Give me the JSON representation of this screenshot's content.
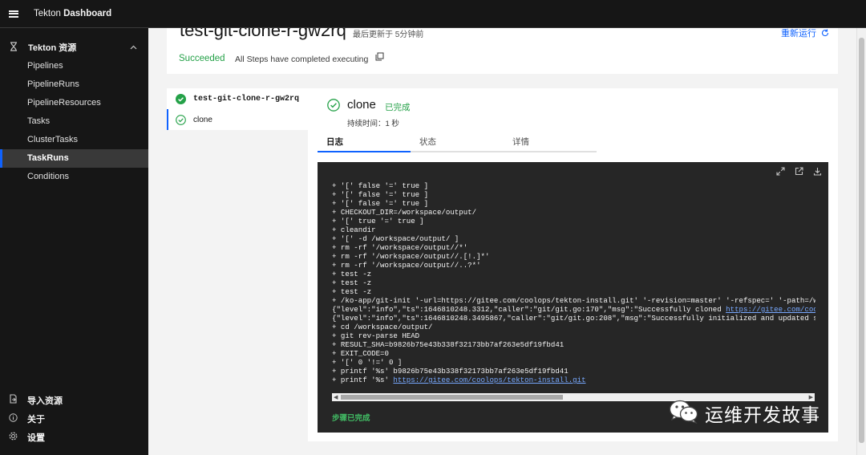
{
  "header": {
    "brand_prefix": "Tekton ",
    "brand_strong": "Dashboard"
  },
  "sidebar": {
    "group_label": "Tekton 资源",
    "items": [
      {
        "label": "Pipelines"
      },
      {
        "label": "PipelineRuns"
      },
      {
        "label": "PipelineResources"
      },
      {
        "label": "Tasks"
      },
      {
        "label": "ClusterTasks"
      },
      {
        "label": "TaskRuns",
        "active": true
      },
      {
        "label": "Conditions"
      }
    ],
    "bottom": [
      {
        "icon": "import-icon",
        "label": "导入资源"
      },
      {
        "icon": "info-icon",
        "label": "关于"
      },
      {
        "icon": "gear-icon",
        "label": "设置"
      }
    ]
  },
  "run": {
    "title": "test-git-clone-r-gw2rq",
    "updated": "最后更新于 5分钟前",
    "rerun_label": "重新运行",
    "status": "Succeeded",
    "status_message": "All Steps have completed executing"
  },
  "steps": [
    {
      "label": "test-git-clone-r-gw2rq",
      "state": "succeeded-filled"
    },
    {
      "label": "clone",
      "state": "succeeded-outline",
      "selected": true
    }
  ],
  "detail": {
    "title": "clone",
    "status": "已完成",
    "duration": "持续时间：1 秒",
    "tabs": [
      {
        "label": "日志",
        "active": true
      },
      {
        "label": "状态"
      },
      {
        "label": "详情"
      }
    ]
  },
  "log": {
    "lines": [
      {
        "text": "+ '[' false '=' true ]"
      },
      {
        "text": "+ '[' false '=' true ]"
      },
      {
        "text": "+ '[' false '=' true ]"
      },
      {
        "text": "+ CHECKOUT_DIR=/workspace/output/"
      },
      {
        "text": "+ '[' true '=' true ]"
      },
      {
        "text": "+ cleandir"
      },
      {
        "text": "+ '[' -d /workspace/output/ ]"
      },
      {
        "text": "+ rm -rf '/workspace/output//*'"
      },
      {
        "text": "+ rm -rf '/workspace/output//.[!.]*'"
      },
      {
        "text": "+ rm -rf '/workspace/output//..?*'"
      },
      {
        "text": "+ test -z"
      },
      {
        "text": "+ test -z"
      },
      {
        "text": "+ test -z"
      },
      {
        "text": "+ /ko-app/git-init '-url=https://gitee.com/coolops/tekton-install.git' '-revision=master' '-refspec=' '-path=/wor"
      },
      {
        "text": "{\"level\":\"info\",\"ts\":1646810248.3312,\"caller\":\"git/git.go:170\",\"msg\":\"Successfully cloned ",
        "link": "https://gitee.com/coolo"
      },
      {
        "text": "{\"level\":\"info\",\"ts\":1646810248.3495867,\"caller\":\"git/git.go:208\",\"msg\":\"Successfully initialized and updated sub"
      },
      {
        "text": "+ cd /workspace/output/"
      },
      {
        "text": "+ git rev-parse HEAD"
      },
      {
        "text": "+ RESULT_SHA=b9826b75e43b338f32173bb7af263e5df19fbd41"
      },
      {
        "text": "+ EXIT_CODE=0"
      },
      {
        "text": "+ '[' 0 '!=' 0 ]"
      },
      {
        "text": "+ printf '%s' b9826b75e43b338f32173bb7af263e5df19fbd41"
      },
      {
        "text": "+ printf '%s' ",
        "link": "https://gitee.com/coolops/tekton-install.git"
      }
    ],
    "footer": "步骤已完成",
    "tools": [
      "maximize-icon",
      "launch-icon",
      "download-icon"
    ]
  },
  "watermark": {
    "text": "运维开发故事"
  },
  "colors": {
    "success": "#24a148",
    "link": "#0f62fe",
    "sidebar_bg": "#161616",
    "log_bg": "#262626"
  }
}
